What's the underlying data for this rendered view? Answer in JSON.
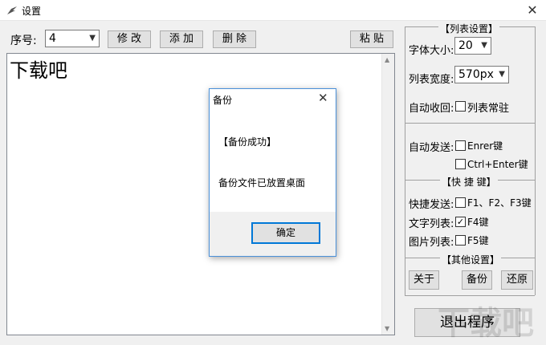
{
  "window": {
    "title": "设置",
    "close_glyph": "✕"
  },
  "toolbar": {
    "seq_label": "序号:",
    "seq_value": "4",
    "modify": "修 改",
    "add": "添 加",
    "delete": "删 除",
    "paste": "粘 贴"
  },
  "editor": {
    "text": "下载吧"
  },
  "panel": {
    "list_settings": "【列表设置】",
    "font_size_label": "字体大小:",
    "font_size_value": "20",
    "list_width_label": "列表宽度:",
    "list_width_value": "570px",
    "auto_collapse_label": "自动收回:",
    "list_pin_label": "列表常驻",
    "auto_send_label": "自动发送:",
    "enter_label": "Enrer键",
    "ctrl_enter_label": "Ctrl+Enter键",
    "shortcuts_title": "【快 捷 键】",
    "quick_send_label": "快捷发送:",
    "f1f2f3_label": "F1、F2、F3键",
    "text_list_label": "文字列表:",
    "f4_label": "F4键",
    "f4_checked": "✓",
    "image_list_label": "图片列表:",
    "f5_label": "F5键",
    "other_title": "【其他设置】",
    "about": "关于",
    "backup": "备份",
    "restore": "还原",
    "exit": "退出程序"
  },
  "dialog": {
    "title": "备份",
    "close_glyph": "✕",
    "line1": "【备份成功】",
    "line2": "备份文件已放置桌面",
    "ok": "确定"
  },
  "watermark": "下载吧"
}
